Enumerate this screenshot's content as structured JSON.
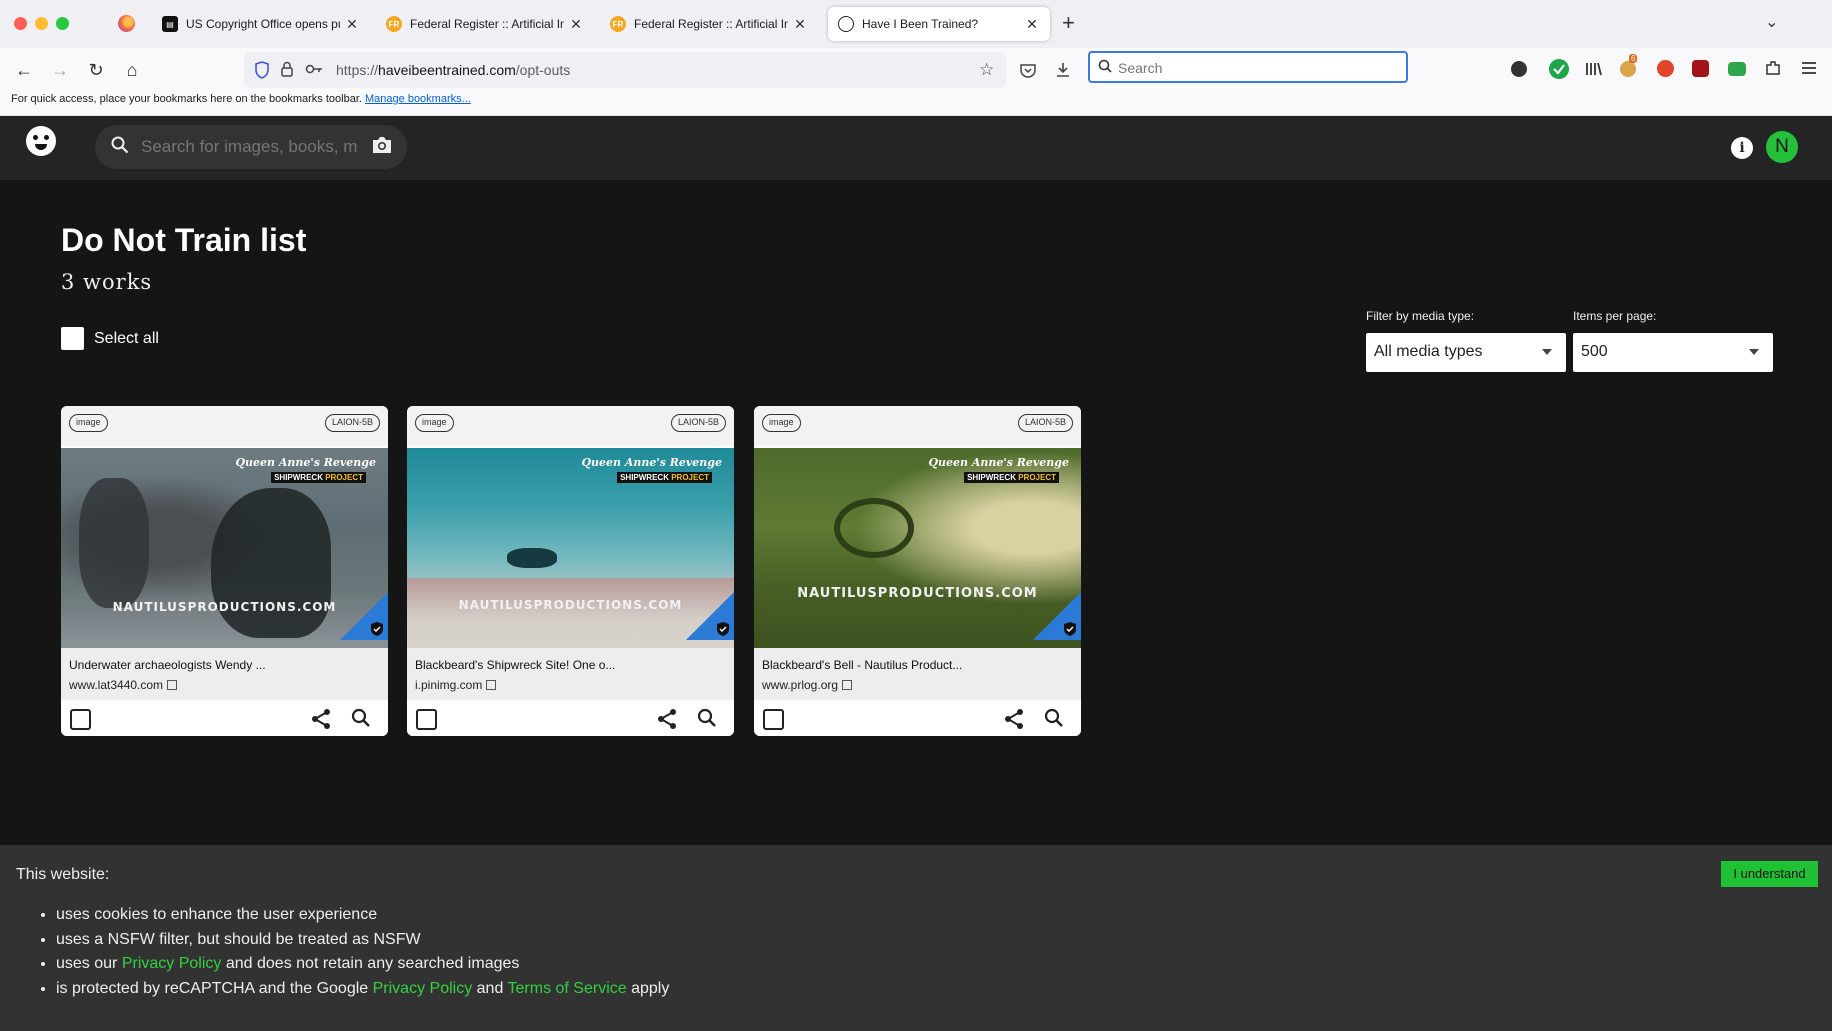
{
  "browser": {
    "tabs": [
      {
        "title": "US Copyright Office opens publ",
        "favicon": "doc-icon"
      },
      {
        "title": "Federal Register :: Artificial Intel",
        "favicon": "fr-icon"
      },
      {
        "title": "Federal Register :: Artificial Intel",
        "favicon": "fr-icon"
      },
      {
        "title": "Have I Been Trained?",
        "favicon": "hibt-icon"
      }
    ],
    "url_prefix": "https://",
    "url_domain": "haveibeentrained.com",
    "url_path": "/opt-outs",
    "search_placeholder": "Search",
    "bookmarks_text": "For quick access, place your bookmarks here on the bookmarks toolbar.",
    "bookmarks_link": "Manage bookmarks...",
    "extension_badge": "6"
  },
  "site": {
    "search_placeholder": "Search for images, books, ma",
    "avatar_letter": "N",
    "info_label": "i"
  },
  "main": {
    "title": "Do Not Train list",
    "count": "3 works",
    "select_all": "Select all",
    "filter_label": "Filter by media type:",
    "filter_value": "All media types",
    "per_page_label": "Items per page:",
    "per_page_value": "500"
  },
  "cards": [
    {
      "type": "image",
      "dataset": "LAION-5B",
      "title": "Underwater archaeologists Wendy ...",
      "source": "www.lat3440.com",
      "watermark": "NAUTILUSPRODUCTIONS.COM"
    },
    {
      "type": "image",
      "dataset": "LAION-5B",
      "title": "Blackbeard's Shipwreck Site! One o...",
      "source": "i.pinimg.com",
      "watermark": "NAUTILUSPRODUCTIONS.COM"
    },
    {
      "type": "image",
      "dataset": "LAION-5B",
      "title": "Blackbeard's Bell - Nautilus Product...",
      "source": "www.prlog.org",
      "watermark": "NAUTILUSPRODUCTIONS.COM"
    }
  ],
  "brand_overlay": {
    "line1": "Queen Anne's Revenge",
    "line2a": "SHIPWRECK",
    "line2b": "PROJECT"
  },
  "cookie": {
    "heading": "This website:",
    "item1": "uses cookies to enhance the user experience",
    "item2": "uses a NSFW filter, but should be treated as NSFW",
    "item3_pre": "uses our",
    "item3_link": "Privacy Policy",
    "item3_post": "and does not retain any searched images",
    "item4_pre": "is protected by reCAPTCHA and the Google",
    "item4_link1": "Privacy Policy",
    "item4_mid": "and",
    "item4_link2": "Terms of Service",
    "item4_post": "apply",
    "button": "I understand"
  }
}
